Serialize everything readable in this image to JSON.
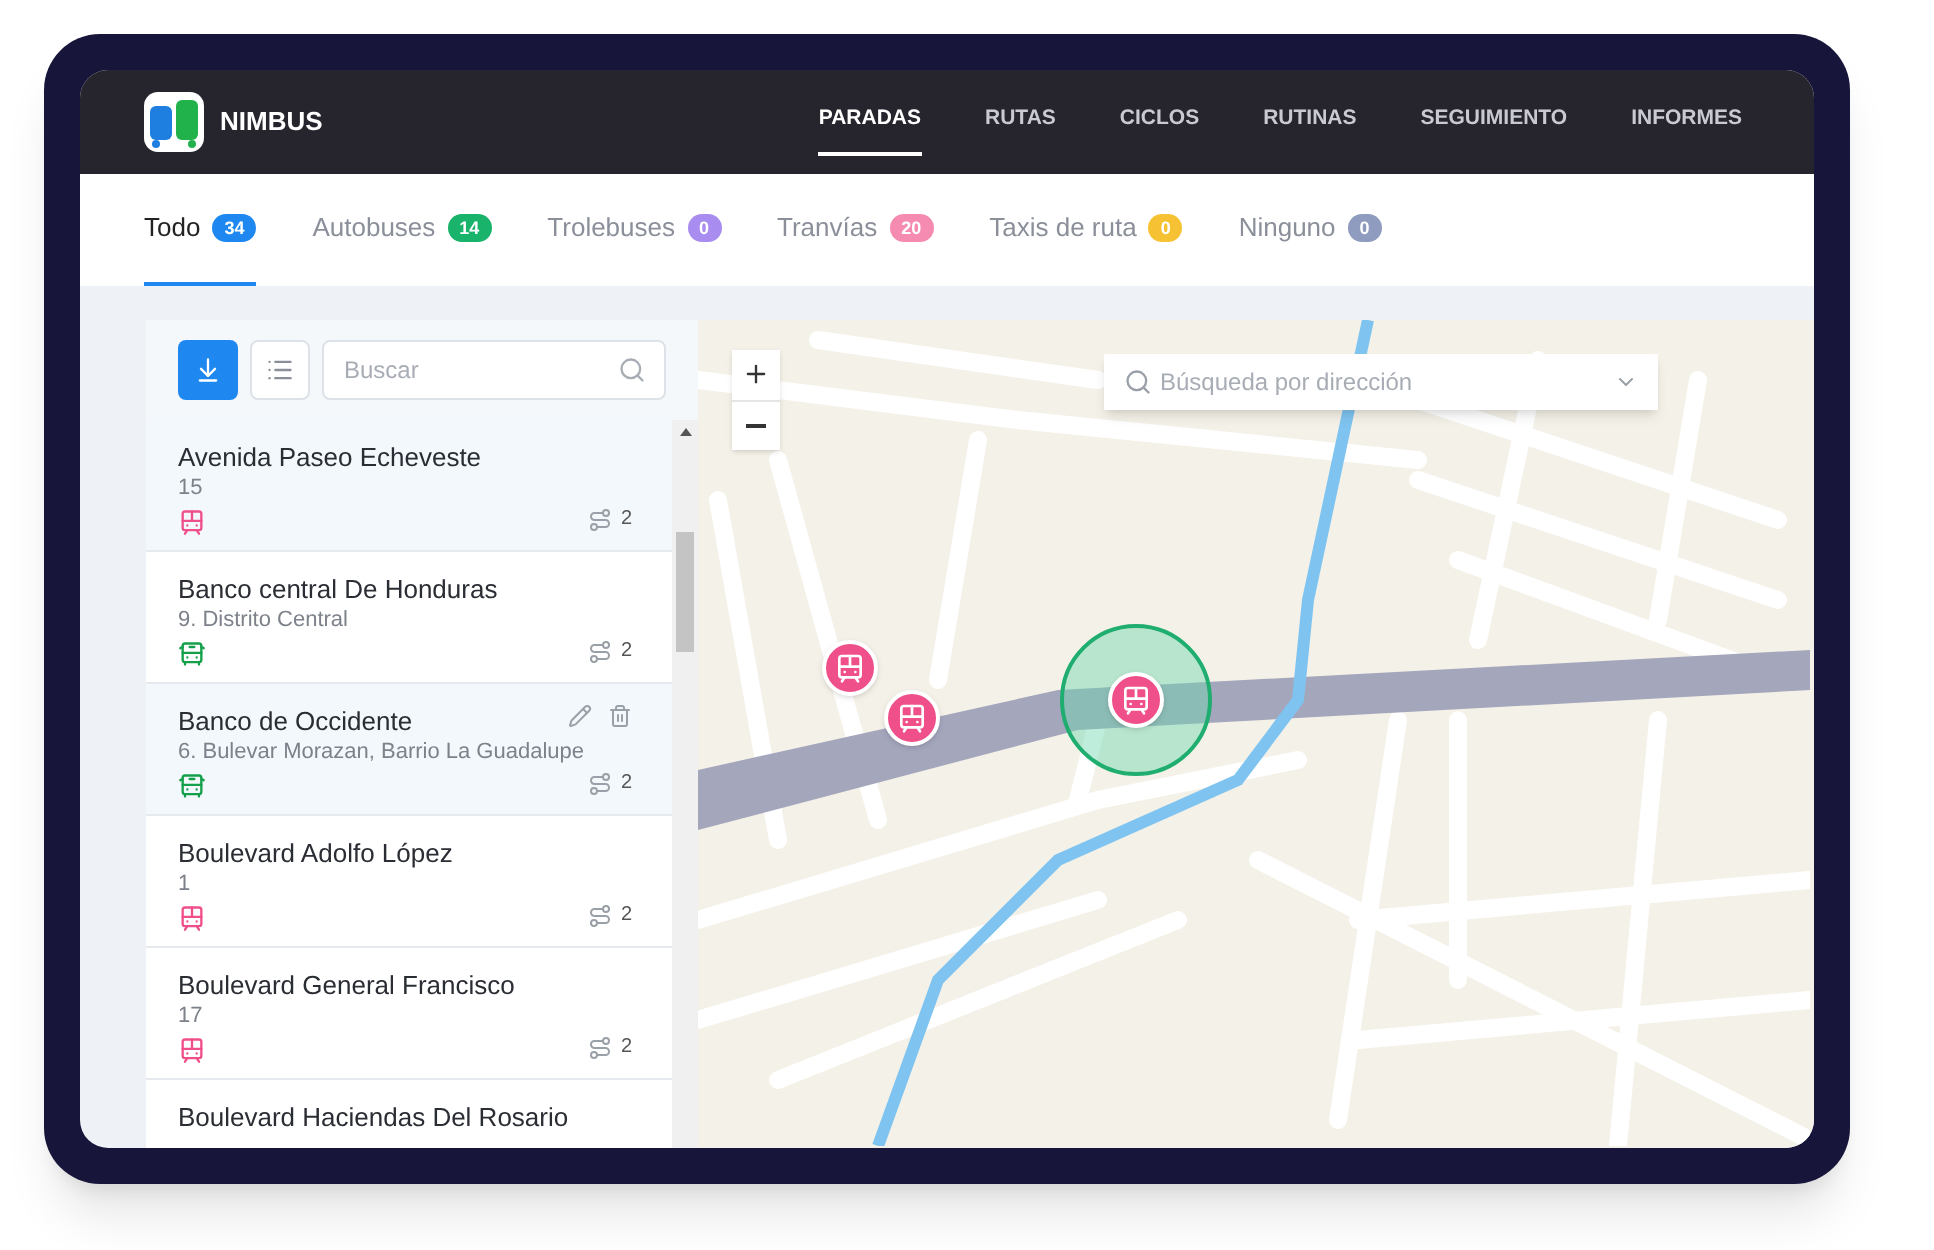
{
  "brand": {
    "name": "NIMBUS"
  },
  "nav": [
    {
      "label": "PARADAS",
      "selected": true
    },
    {
      "label": "RUTAS",
      "selected": false
    },
    {
      "label": "CICLOS",
      "selected": false
    },
    {
      "label": "RUTINAS",
      "selected": false
    },
    {
      "label": "SEGUIMIENTO",
      "selected": false
    },
    {
      "label": "INFORMES",
      "selected": false
    }
  ],
  "tabs": [
    {
      "label": "Todo",
      "count": "34",
      "color": "#1e88f0",
      "selected": true
    },
    {
      "label": "Autobuses",
      "count": "14",
      "color": "#19b36b",
      "selected": false
    },
    {
      "label": "Trolebuses",
      "count": "0",
      "color": "#a98cf0",
      "selected": false
    },
    {
      "label": "Tranvías",
      "count": "20",
      "color": "#f58bb0",
      "selected": false
    },
    {
      "label": "Taxis de ruta",
      "count": "0",
      "color": "#f6c234",
      "selected": false
    },
    {
      "label": "Ninguno",
      "count": "0",
      "color": "#8f9bbf",
      "selected": false
    }
  ],
  "search": {
    "placeholder": "Buscar"
  },
  "stops": [
    {
      "name": "Avenida Paseo Echeveste",
      "detail": "15",
      "kind": "tram",
      "routes": "2",
      "selected": true,
      "show_actions": false
    },
    {
      "name": "Banco central De Honduras",
      "detail": "9. Distrito Central",
      "kind": "bus",
      "routes": "2",
      "selected": false,
      "show_actions": false
    },
    {
      "name": "Banco de Occidente",
      "detail": "6. Bulevar Morazan, Barrio La Guadalupe",
      "kind": "bus",
      "routes": "2",
      "selected": true,
      "show_actions": true
    },
    {
      "name": "Boulevard Adolfo López",
      "detail": "1",
      "kind": "tram",
      "routes": "2",
      "selected": false,
      "show_actions": false
    },
    {
      "name": "Boulevard General Francisco",
      "detail": "17",
      "kind": "tram",
      "routes": "2",
      "selected": false,
      "show_actions": false
    },
    {
      "name": "Boulevard Haciendas Del Rosario",
      "selected": false,
      "show_actions": false
    }
  ],
  "map": {
    "search_placeholder": "Búsqueda por dirección"
  }
}
